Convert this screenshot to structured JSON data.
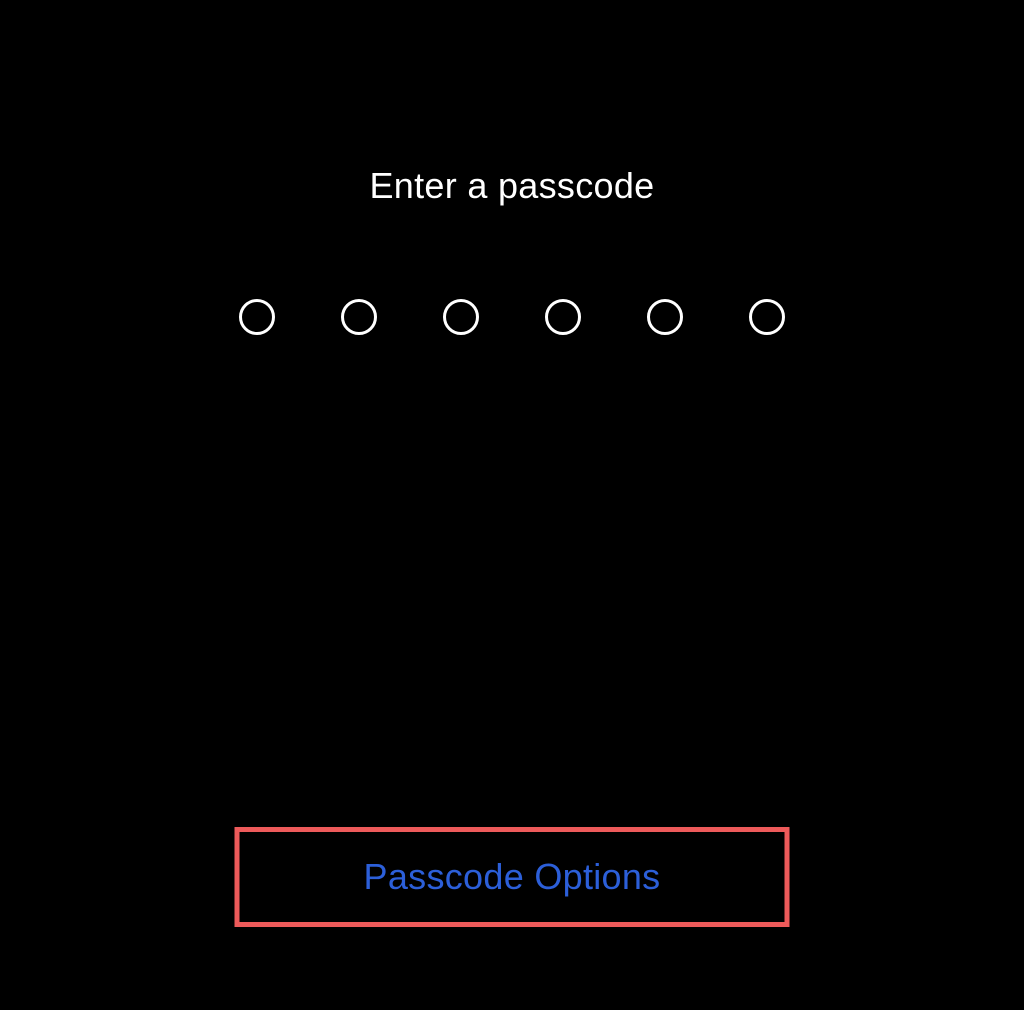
{
  "passcode": {
    "title": "Enter a passcode",
    "digit_count": 6,
    "options_button_label": "Passcode Options"
  },
  "colors": {
    "background": "#000000",
    "text": "#ffffff",
    "link": "#2c5fd9",
    "highlight_border": "#ed5a5a"
  }
}
